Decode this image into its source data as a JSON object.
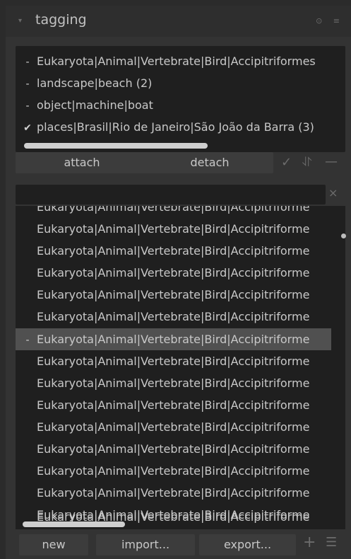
{
  "header": {
    "title": "tagging",
    "collapse_icon": "▾",
    "icons": "⊙ ≡"
  },
  "attached": {
    "rows": [
      {
        "icon": "-",
        "label": "Eukaryota|Animal|Vertebrate|Bird|Accipitriformes"
      },
      {
        "icon": "-",
        "label": "landscape|beach (2)"
      },
      {
        "icon": "-",
        "label": "object|machine|boat"
      },
      {
        "icon": "✔",
        "label": "places|Brasil|Rio de Janeiro|São João da Barra (3)"
      }
    ]
  },
  "buttons": {
    "attach": "attach",
    "detach": "detach",
    "new": "new",
    "import": "import...",
    "export": "export..."
  },
  "tools": {
    "check": "✓",
    "sort": "⥯",
    "minus": "—",
    "clear": "×",
    "plus": "+",
    "list": "☰"
  },
  "search": {
    "value": "",
    "placeholder": ""
  },
  "dictionary": {
    "rows": [
      {
        "icon": "",
        "label": "Eukaryota|Animal|Vertebrate|Bird|Accipitriforme",
        "selected": false
      },
      {
        "icon": "",
        "label": "Eukaryota|Animal|Vertebrate|Bird|Accipitriforme",
        "selected": false
      },
      {
        "icon": "",
        "label": "Eukaryota|Animal|Vertebrate|Bird|Accipitriforme",
        "selected": false
      },
      {
        "icon": "",
        "label": "Eukaryota|Animal|Vertebrate|Bird|Accipitriforme",
        "selected": false
      },
      {
        "icon": "",
        "label": "Eukaryota|Animal|Vertebrate|Bird|Accipitriforme",
        "selected": false
      },
      {
        "icon": "",
        "label": "Eukaryota|Animal|Vertebrate|Bird|Accipitriforme",
        "selected": false
      },
      {
        "icon": "-",
        "label": "Eukaryota|Animal|Vertebrate|Bird|Accipitriforme",
        "selected": true
      },
      {
        "icon": "",
        "label": "Eukaryota|Animal|Vertebrate|Bird|Accipitriforme",
        "selected": false
      },
      {
        "icon": "",
        "label": "Eukaryota|Animal|Vertebrate|Bird|Accipitriforme",
        "selected": false
      },
      {
        "icon": "",
        "label": "Eukaryota|Animal|Vertebrate|Bird|Accipitriforme",
        "selected": false
      },
      {
        "icon": "",
        "label": "Eukaryota|Animal|Vertebrate|Bird|Accipitriforme",
        "selected": false
      },
      {
        "icon": "",
        "label": "Eukaryota|Animal|Vertebrate|Bird|Accipitriforme",
        "selected": false
      },
      {
        "icon": "",
        "label": "Eukaryota|Animal|Vertebrate|Bird|Accipitriforme",
        "selected": false
      },
      {
        "icon": "",
        "label": "Eukaryota|Animal|Vertebrate|Bird|Accipitriforme",
        "selected": false
      },
      {
        "icon": "",
        "label": "Eukaryota|Animal|Vertebrate|Bird|Accipitriforme",
        "selected": false
      },
      {
        "icon": "",
        "label": "Eukaryota|Animal|Vertebrate|Bird|Accipitriforme",
        "selected": false
      }
    ]
  },
  "colors": {
    "background": "#2b2b2b",
    "panel": "#333333",
    "list_bg": "#1f1f1f",
    "selected_row": "#505050",
    "button": "#3c3c3c"
  }
}
